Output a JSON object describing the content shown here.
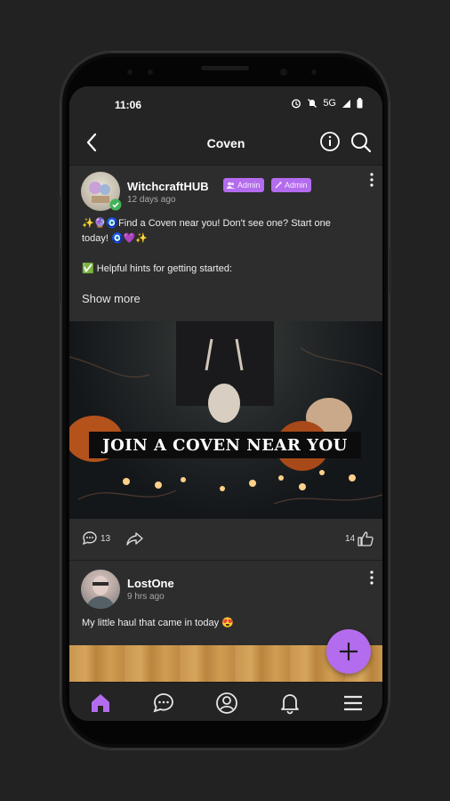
{
  "status_bar": {
    "time": "11:06",
    "network": "5G"
  },
  "header": {
    "title": "Coven"
  },
  "posts": [
    {
      "author": "WitchcraftHUB",
      "time_ago": "12 days ago",
      "badges": [
        "Admin",
        "Admin"
      ],
      "text_line1": "✨🔮🧿Find a Coven near you! Don't see one? Start one",
      "text_line2": "today! 🧿💜✨",
      "text_line3": "✅ Helpful hints for getting started:",
      "show_more": "Show more",
      "image_caption": "JOIN A COVEN NEAR YOU",
      "comments_count": "13",
      "likes_count": "14"
    },
    {
      "author": "LostOne",
      "time_ago": "9 hrs ago",
      "text": "My little haul that came in today 😍"
    }
  ],
  "bottom_nav": [
    "home",
    "chat",
    "profile",
    "notifications",
    "menu"
  ],
  "colors": {
    "accent": "#b46cee",
    "background": "#2d2d2d",
    "bar": "#242424"
  }
}
